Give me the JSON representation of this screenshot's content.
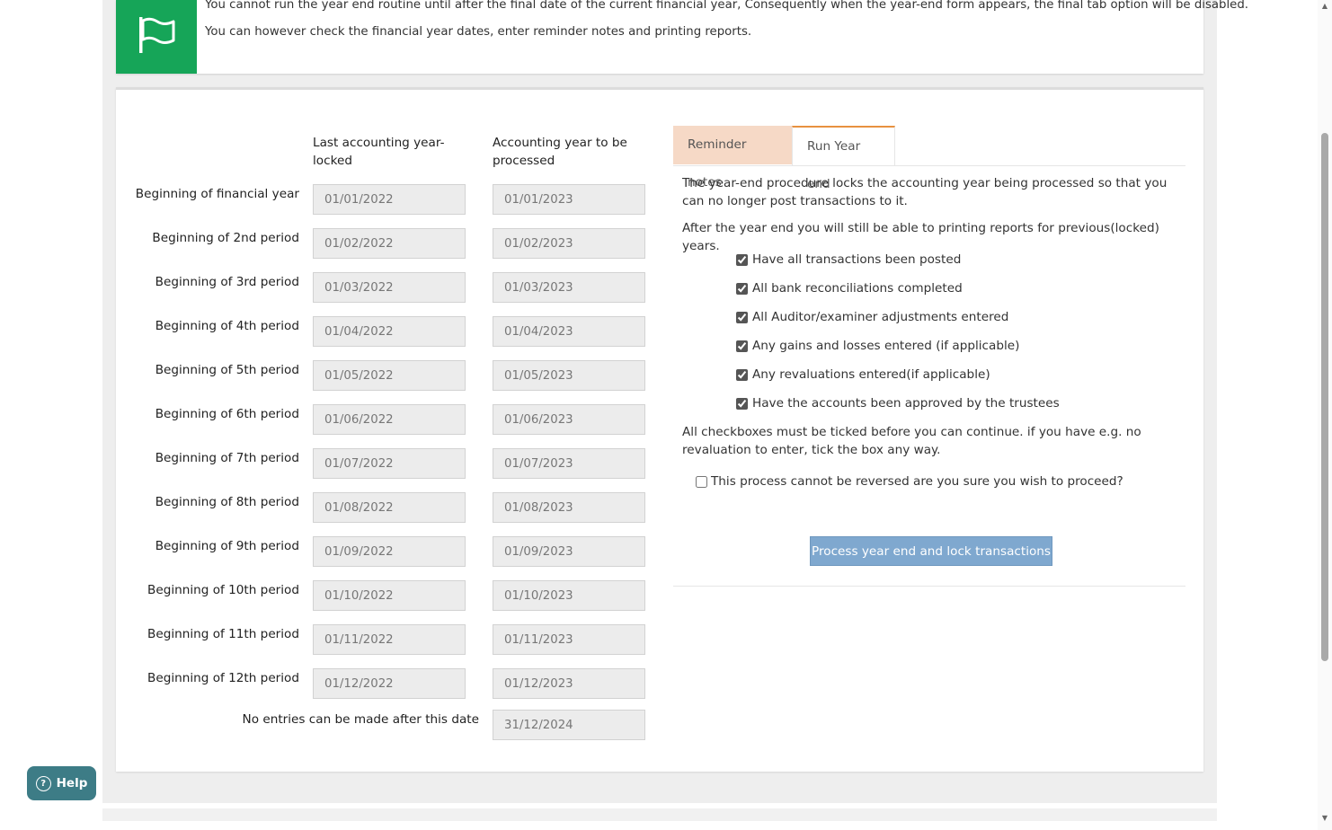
{
  "notice": {
    "icon": "flag-icon",
    "line1": "You cannot run the year end routine until after the final date of the current financial year, Consequently when the year-end form appears, the final tab option will be disabled.",
    "line2": "You can however check the financial year dates, enter reminder notes and printing reports."
  },
  "periods": {
    "header_last": "Last accounting year-locked",
    "header_last_line1": "Last accounting year-",
    "header_last_line2": "locked",
    "header_next_line1": "Accounting year to be",
    "header_next_line2": "processed",
    "rows": [
      {
        "label": "Beginning of financial year",
        "last": "01/01/2022",
        "next": "01/01/2023"
      },
      {
        "label": "Beginning of 2nd period",
        "last": "01/02/2022",
        "next": "01/02/2023"
      },
      {
        "label": "Beginning of 3rd period",
        "last": "01/03/2022",
        "next": "01/03/2023"
      },
      {
        "label": "Beginning of 4th period",
        "last": "01/04/2022",
        "next": "01/04/2023"
      },
      {
        "label": "Beginning of 5th period",
        "last": "01/05/2022",
        "next": "01/05/2023"
      },
      {
        "label": "Beginning of 6th period",
        "last": "01/06/2022",
        "next": "01/06/2023"
      },
      {
        "label": "Beginning of 7th period",
        "last": "01/07/2022",
        "next": "01/07/2023"
      },
      {
        "label": "Beginning of 8th period",
        "last": "01/08/2022",
        "next": "01/08/2023"
      },
      {
        "label": "Beginning of 9th period",
        "last": "01/09/2022",
        "next": "01/09/2023"
      },
      {
        "label": "Beginning of 10th period",
        "last": "01/10/2022",
        "next": "01/10/2023"
      },
      {
        "label": "Beginning of 11th period",
        "last": "01/11/2022",
        "next": "01/11/2023"
      },
      {
        "label": "Beginning of 12th period",
        "last": "01/12/2022",
        "next": "01/12/2023"
      }
    ],
    "final_label": "No entries can be made after this date",
    "final_value": "31/12/2024"
  },
  "tabs": {
    "reminder": "Reminder notes",
    "run": "Run Year end",
    "active": "Run Year end"
  },
  "run_panel": {
    "intro1": "The year-end procedure locks the accounting year being processed so that you can no longer post transactions to it.",
    "intro2": "After the year end you will still be able to printing reports for previous(locked) years.",
    "checks": [
      {
        "label": "Have all transactions been posted",
        "checked": true
      },
      {
        "label": "All bank reconciliations completed",
        "checked": true
      },
      {
        "label": "All Auditor/examiner adjustments entered",
        "checked": true
      },
      {
        "label": "Any gains and losses entered (if applicable)",
        "checked": true
      },
      {
        "label": "Any revaluations entered(if applicable)",
        "checked": true
      },
      {
        "label": "Have the accounts been approved by the trustees",
        "checked": true
      }
    ],
    "note": "All checkboxes must be ticked before you can continue. if you have e.g. no revaluation to enter, tick the box any way.",
    "confirm": "This process cannot be reversed are you sure you wish to proceed?",
    "confirm_checked": false,
    "button": "Process year end and lock transactions"
  },
  "help": {
    "label": "Help",
    "icon": "question-circle-icon"
  },
  "colors": {
    "flag_bg": "#16a558",
    "tab_inactive_bg": "#f6d9c6",
    "tab_active_border": "#e8913f",
    "button_bg": "#7fa8cf",
    "help_bg": "#3d7c86"
  }
}
